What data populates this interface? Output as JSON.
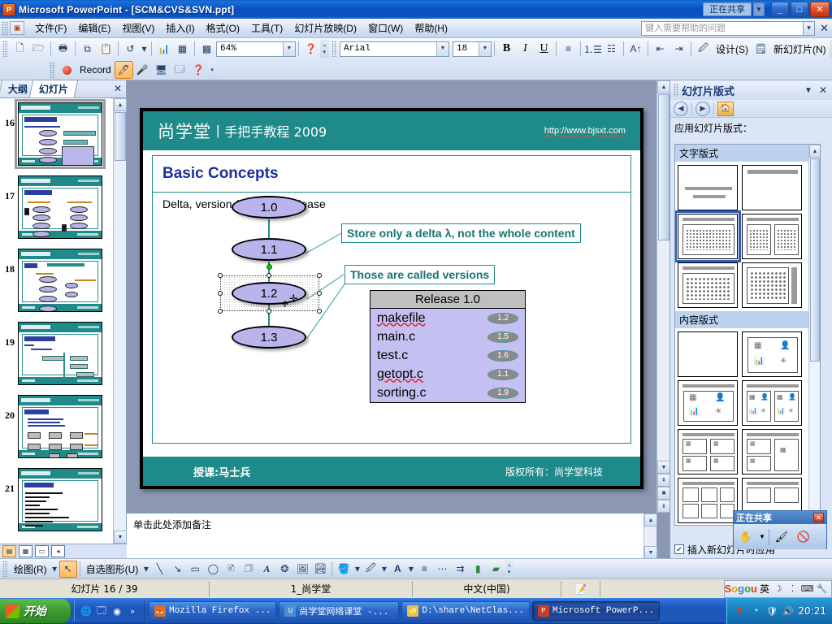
{
  "window": {
    "title": "Microsoft PowerPoint - [SCM&CVS&SVN.ppt]",
    "share_status": "正在共享",
    "minimize": "_",
    "maximize": "□",
    "close": "✕"
  },
  "menubar": {
    "items": [
      {
        "label": "文件(F)"
      },
      {
        "label": "编辑(E)"
      },
      {
        "label": "视图(V)"
      },
      {
        "label": "插入(I)"
      },
      {
        "label": "格式(O)"
      },
      {
        "label": "工具(T)"
      },
      {
        "label": "幻灯片放映(D)"
      },
      {
        "label": "窗口(W)"
      },
      {
        "label": "帮助(H)"
      }
    ],
    "ask_placeholder": "键入需要帮助的问题",
    "close_label": "✕"
  },
  "toolbar": {
    "zoom_value": "64%",
    "font_name": "Arial",
    "font_size": "18",
    "bold": "B",
    "italic": "I",
    "underline": "U",
    "design_label": "设计(S)",
    "new_slide_label": "新幻灯片(N)",
    "record_label": "Record"
  },
  "left_pane": {
    "tabs": [
      {
        "label": "大纲",
        "selected": false
      },
      {
        "label": "幻灯片",
        "selected": true
      }
    ],
    "close_label": "✕",
    "thumbnails": [
      {
        "number": "16",
        "selected": true
      },
      {
        "number": "17",
        "selected": false
      },
      {
        "number": "18",
        "selected": false
      },
      {
        "number": "19",
        "selected": false
      },
      {
        "number": "20",
        "selected": false
      },
      {
        "number": "21",
        "selected": false
      }
    ]
  },
  "slide": {
    "header_logo": "尚学堂",
    "header_sep": "|",
    "header_sub": "手把手教程 2009",
    "header_url": "http://www.bjsxt.com",
    "title": "Basic Concepts",
    "subtitle": "Delta, version (revision), release",
    "nodes": [
      {
        "label": "1.0"
      },
      {
        "label": "1.1"
      },
      {
        "label": "1.2"
      },
      {
        "label": "1.3"
      }
    ],
    "callouts": [
      {
        "text": "Store only a delta λ, not the whole content"
      },
      {
        "text": "Those are called versions"
      }
    ],
    "release_table": {
      "header": "Release 1.0",
      "rows": [
        {
          "name": "makefile",
          "version": "1.2"
        },
        {
          "name": "main.c",
          "version": "1.5"
        },
        {
          "name": "test.c",
          "version": "1.6"
        },
        {
          "name": "getopt.c",
          "version": "1.1"
        },
        {
          "name": "sorting.c",
          "version": "1.9"
        }
      ]
    },
    "footer_left": "授课:马士兵",
    "footer_right": "版权所有：尚学堂科技"
  },
  "notes": {
    "placeholder": "单击此处添加备注"
  },
  "task_pane": {
    "title": "幻灯片版式",
    "dropdown": "▼",
    "close": "✕",
    "apply_label": "应用幻灯片版式：",
    "sections": [
      {
        "label": "文字版式"
      },
      {
        "label": "内容版式"
      }
    ],
    "footer_checkbox_label": "插入新幻灯片时应用",
    "checkbox_checked": "✔"
  },
  "share_float": {
    "title": "正在共享",
    "close": "✕"
  },
  "drawing_toolbar": {
    "draw_label": "绘图(R)",
    "autoshapes_label": "自选图形(U)"
  },
  "statusbar": {
    "slide_counter": "幻灯片 16 / 39",
    "design_name": "1_尚学堂",
    "language": "中文(中国)",
    "ime": "Sogou英"
  },
  "taskbar": {
    "start_label": "开始",
    "tasks": [
      {
        "label": "Mozilla Firefox ...",
        "active": false,
        "color": "#e07020"
      },
      {
        "label": "尚学堂网络课堂 -...",
        "active": false,
        "color": "#4a90d0"
      },
      {
        "label": "D:\\share\\NetClas...",
        "active": false,
        "color": "#e8c050"
      },
      {
        "label": "Microsoft PowerP...",
        "active": true,
        "color": "#c84020"
      }
    ],
    "clock": "20:21"
  },
  "colors": {
    "teal": "#1e8a8a",
    "slide_title_blue": "#1a2fa0",
    "node_fill": "#b9b4ec",
    "table_fill": "#c5c0f2",
    "callout_text": "#157474"
  }
}
